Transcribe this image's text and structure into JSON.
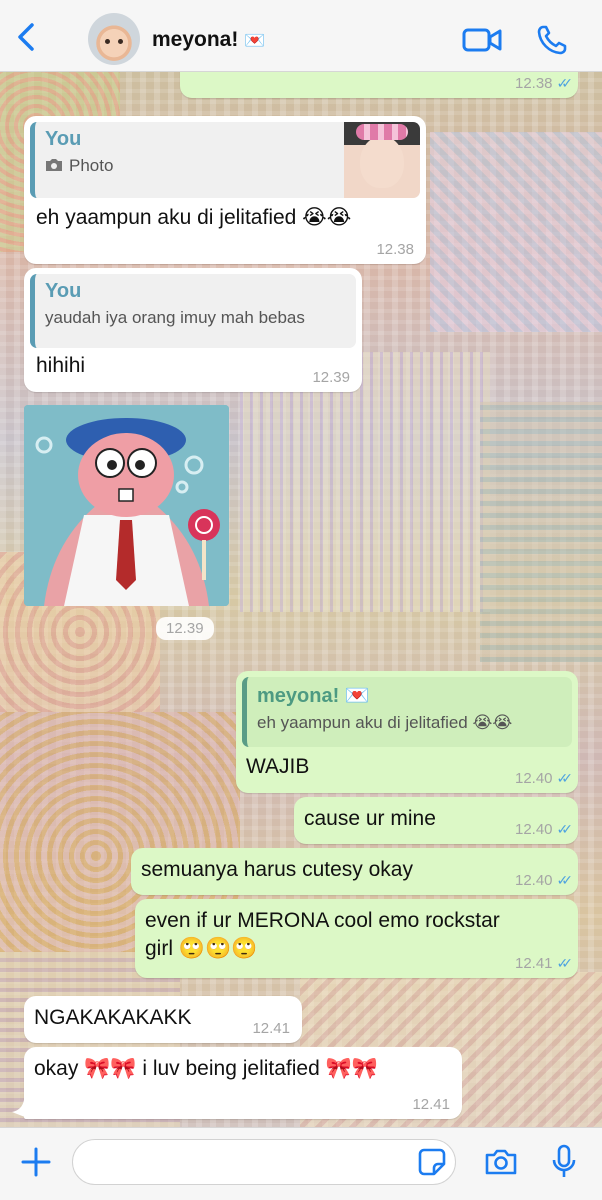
{
  "header": {
    "contact_name": "meyona!",
    "heart": "💌"
  },
  "messages": [
    {
      "dir": "out",
      "time": "12.38"
    },
    {
      "dir": "in",
      "quote_name": "You",
      "quote_text": "Photo",
      "text": "eh yaampun aku di jelitafied 😭😭",
      "time": "12.38"
    },
    {
      "dir": "in",
      "quote_name": "You",
      "quote_text": "yaudah iya orang imuy mah bebas",
      "text": "hihihi",
      "time": "12.39"
    },
    {
      "dir": "in",
      "type": "sticker",
      "time": "12.39"
    },
    {
      "dir": "out",
      "quote_name": "meyona! 💌",
      "quote_text": "eh yaampun aku di jelitafied 😭😭",
      "text": "WAJIB",
      "time": "12.40"
    },
    {
      "dir": "out",
      "text": "cause ur mine",
      "time": "12.40"
    },
    {
      "dir": "out",
      "text": "semuanya harus cutesy okay",
      "time": "12.40"
    },
    {
      "dir": "out",
      "text_line1": "even if ur MERONA cool emo rockstar",
      "text_line2": "girl 🙄🙄🙄",
      "time": "12.41"
    },
    {
      "dir": "in",
      "text": "NGAKAKAKAKK",
      "time": "12.41"
    },
    {
      "dir": "in",
      "text": "okay 🎀🎀 i luv being jelitafied 🎀🎀",
      "time": "12.41"
    }
  ],
  "ticks": "✓✓",
  "composer": {
    "placeholder": ""
  },
  "colors": {
    "accent": "#1c7cf0",
    "outgoing_bubble": "#dcf8c6",
    "incoming_bubble": "#ffffff",
    "read_ticks": "#4fa3e0"
  },
  "icons": [
    "back-chevron-icon",
    "video-call-icon",
    "phone-icon",
    "camera-icon",
    "plus-icon",
    "sticker-icon",
    "microphone-icon"
  ]
}
